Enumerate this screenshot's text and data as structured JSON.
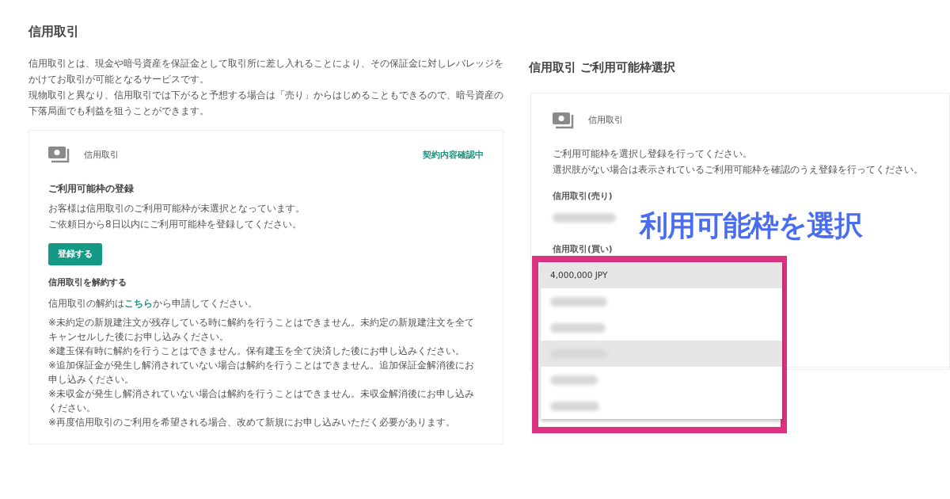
{
  "left": {
    "title": "信用取引",
    "intro": [
      "信用取引とは、現金や暗号資産を保証金として取引所に差し入れることにより、その保証金に対しレバレッジをかけてお取引が可能となるサービスです。",
      "現物取引と異なり、信用取引では下がると予想する場合は「売り」からはじめることもできるので、暗号資産の下落局面でも利益を狙うことができます。"
    ],
    "card": {
      "service": "信用取引",
      "status": "契約内容確認中",
      "register_heading": "ご利用可能枠の登録",
      "register_text": [
        "お客様は信用取引のご利用可能枠が未選択となっています。",
        "ご依頼日から8日以内にご利用可能枠を登録してください。"
      ],
      "register_button": "登録する",
      "cancel_heading": "信用取引を解約する",
      "cancel_text_before": "信用取引の解約は",
      "cancel_link": "こちら",
      "cancel_text_after": "から申請してください。",
      "notes": [
        "※未約定の新規建注文が残存している時に解約を行うことはできません。未約定の新規建注文を全てキャンセルした後にお申し込みください。",
        "※建玉保有時に解約を行うことはできません。保有建玉を全て決済した後にお申し込みください。",
        "※追加保証金が発生し解消されていない場合は解約を行うことはできません。追加保証金解消後にお申し込みください。",
        "※未収金が発生し解消されていない場合は解約を行うことはできません。未収金解消後にお申し込みください。",
        "※再度信用取引のご利用を希望される場合、改めて新規にお申し込みいただく必要があります。"
      ]
    }
  },
  "right": {
    "title": "信用取引 ご利用可能枠選択",
    "card": {
      "service": "信用取引",
      "instructions": [
        "ご利用可能枠を選択し登録を行ってください。",
        "選択肢がない場合は表示されているご利用可能枠を確認のうえ登録を行ってください。"
      ],
      "sell_label": "信用取引(売り)",
      "buy_label": "信用取引(買い)",
      "dropdown": [
        {
          "kind": "text",
          "label": "4,000,000 JPY",
          "highlighted": true
        },
        {
          "kind": "redacted",
          "highlighted": false
        },
        {
          "kind": "redacted",
          "highlighted": false
        },
        {
          "kind": "redacted",
          "highlighted": true
        },
        {
          "kind": "redacted",
          "highlighted": false
        },
        {
          "kind": "redacted",
          "highlighted": false
        }
      ]
    },
    "callout": "利用可能枠を選択"
  }
}
